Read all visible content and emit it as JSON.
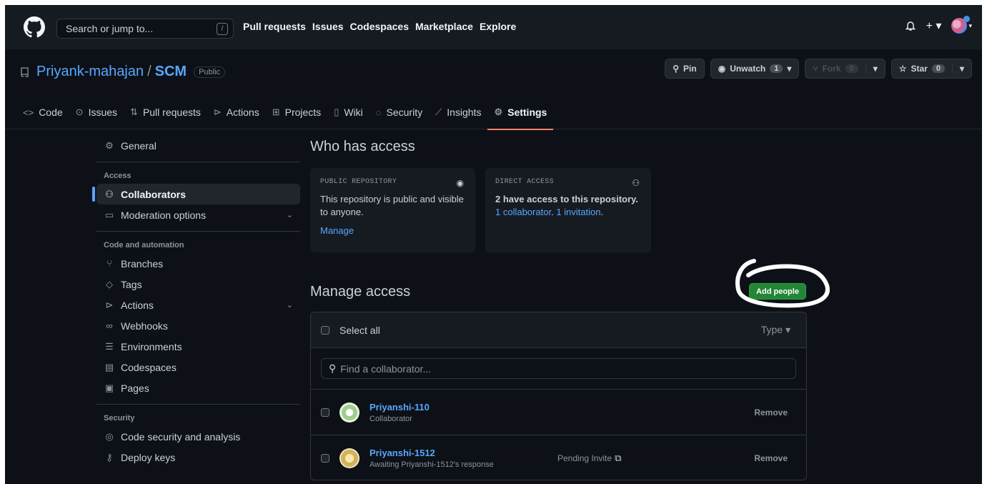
{
  "header": {
    "search_placeholder": "Search or jump to...",
    "search_key": "/",
    "nav": [
      "Pull requests",
      "Issues",
      "Codespaces",
      "Marketplace",
      "Explore"
    ]
  },
  "repo": {
    "owner": "Priyank-mahajan",
    "separator": "/",
    "name": "SCM",
    "visibility": "Public",
    "actions": {
      "pin": "Pin",
      "unwatch": "Unwatch",
      "unwatch_count": "1",
      "fork": "Fork",
      "fork_count": "0",
      "star": "Star",
      "star_count": "0"
    },
    "tabs": [
      "Code",
      "Issues",
      "Pull requests",
      "Actions",
      "Projects",
      "Wiki",
      "Security",
      "Insights",
      "Settings"
    ],
    "active_tab": "Settings"
  },
  "sidebar": {
    "general": "General",
    "access_heading": "Access",
    "collaborators": "Collaborators",
    "moderation": "Moderation options",
    "code_heading": "Code and automation",
    "branches": "Branches",
    "tags": "Tags",
    "actions": "Actions",
    "webhooks": "Webhooks",
    "environments": "Environments",
    "codespaces": "Codespaces",
    "pages": "Pages",
    "security_heading": "Security",
    "code_security": "Code security and analysis",
    "deploy_keys": "Deploy keys"
  },
  "main": {
    "who_title": "Who has access",
    "public_card": {
      "label": "PUBLIC REPOSITORY",
      "text": "This repository is public and visible to anyone.",
      "link": "Manage"
    },
    "direct_card": {
      "label": "DIRECT ACCESS",
      "text_bold": "2 have access to this repository.",
      "link1": "1 collaborator",
      "dot": ".",
      "link2": "1 invitation",
      "end": "."
    },
    "manage_title": "Manage access",
    "add_button": "Add people",
    "select_all": "Select all",
    "type_filter": "Type ▾",
    "find_placeholder": "Find a collaborator...",
    "rows": [
      {
        "name": "Priyanshi-110",
        "sub": "Collaborator",
        "pending": "",
        "remove": "Remove"
      },
      {
        "name": "Priyanshi-1512",
        "sub": "Awaiting Priyanshi-1512's response",
        "pending": "Pending Invite",
        "remove": "Remove"
      }
    ]
  },
  "colors": {
    "accent": "#58a6ff",
    "primary_button": "#238636",
    "active_tab_underline": "#f78166"
  }
}
